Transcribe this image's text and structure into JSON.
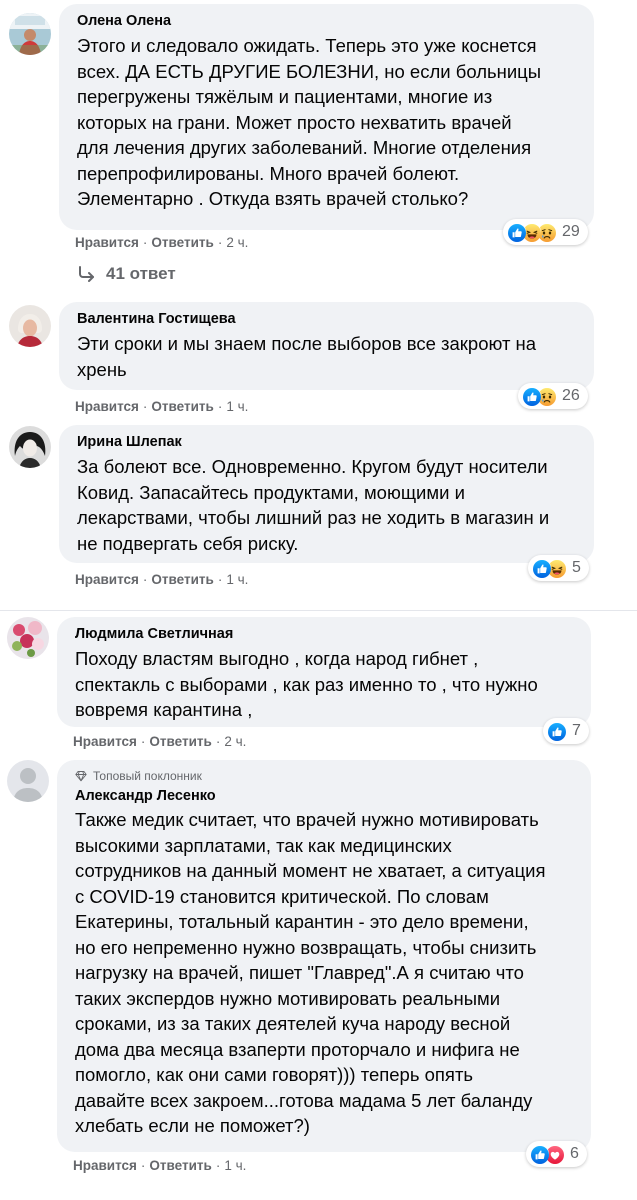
{
  "comments": [
    {
      "author": "Олена Олена",
      "lines": "Этого и следовало ожидать. Теперь это уже коснется\nвсех. ДА ЕСТЬ ДРУГИЕ БОЛЕЗНИ, но если больницы\nперегружены тяжёлым и пациентами, многие из\nкоторых на грани. Может просто нехватить врачей\nдля лечения других заболеваний. Многие отделения\nперепрофилированы. Много врачей болеют.\nЭлементарно . Откуда взять врачей столько?",
      "like": "Нравится",
      "reply": "Ответить",
      "time": "2 ч.",
      "reaction_count": "29",
      "reactions": [
        "like-icon",
        "haha-icon",
        "sad-icon"
      ]
    },
    {
      "author": "Валентина Гостищева",
      "lines": "Эти сроки и мы знаем после выборов все закроют на\nхрень",
      "like": "Нравится",
      "reply": "Ответить",
      "time": "1 ч.",
      "reaction_count": "26",
      "reactions": [
        "like-icon",
        "sad-icon"
      ]
    },
    {
      "author": "Ирина Шлепак",
      "lines": "За болеют все. Одновременно. Кругом будут носители\nКовид. Запасайтесь продуктами, моющими и\nлекарствами, чтобы лишний раз не ходить в магазин и\nне подвергать себя риску.",
      "like": "Нравится",
      "reply": "Ответить",
      "time": "1 ч.",
      "reaction_count": "5",
      "reactions": [
        "like-icon",
        "haha-icon"
      ]
    },
    {
      "author": "Людмила Светличная",
      "lines": "Походу властям выгодно , когда народ гибнет ,\nспектакль с выборами , как раз именно то , что нужно\nвовремя карантина ,",
      "like": "Нравится",
      "reply": "Ответить",
      "time": "2 ч.",
      "reaction_count": "7",
      "reactions": [
        "like-icon"
      ]
    },
    {
      "badge": "Топовый поклонник",
      "author": "Александр Лесенко",
      "lines": "Также медик считает, что врачей нужно мотивировать\nвысокими зарплатами, так как медицинских\nсотрудников на данный момент не хватает, а ситуация\nс COVID-19 становится критической. По словам\nЕкатерины, тотальный карантин - это дело времени,\nно его непременно нужно возвращать, чтобы снизить\nнагрузку на врачей, пишет \"Главред\".А я считаю что\nтаких экспердов нужно мотивировать реальными\nсроками, из за таких деятелей куча народу весной\nдома два месяца взаперти проторчало и нифига не\nпомогло, как они сами говорят))) теперь опять\nдавайте всех закроем...готова мадама 5 лет баланду\nхлебать если не поможет?)",
      "like": "Нравится",
      "reply": "Ответить",
      "time": "1 ч.",
      "reaction_count": "6",
      "reactions": [
        "like-icon",
        "love-icon"
      ]
    }
  ],
  "replies_label": "41 ответ",
  "separator": "·",
  "colors": {
    "bubble": "#f0f2f5",
    "meta_text": "#65676b",
    "like_blue": "#1877f2",
    "haha_yellow": "#f7b125",
    "love_red": "#f33e58"
  }
}
